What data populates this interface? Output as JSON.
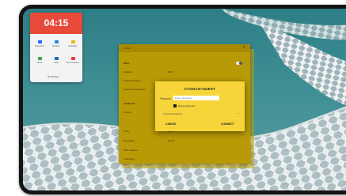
{
  "widget": {
    "clock": "04:15",
    "quick_settings": [
      {
        "label": "Bluetooth",
        "color": "#2962ff"
      },
      {
        "label": "Rotation",
        "color": "#1e88e5"
      },
      {
        "label": "Flashlight",
        "color": "#f2b800"
      },
      {
        "label": "Wi-Fi",
        "color": "#43a047"
      },
      {
        "label": "Data",
        "color": "#1565c0"
      },
      {
        "label": "Do not disturb",
        "color": "#e53935"
      }
    ],
    "settings_label": "Settings"
  },
  "panel": {
    "title": "Wi-Fi",
    "rows": [
      {
        "label": "Wi-Fi",
        "value": ""
      },
      {
        "label": "Network",
        "value": "Wi-Fi"
      },
      {
        "label": "Saved networks",
        "value": ""
      },
      {
        "label": "Network preferences",
        "value": ""
      },
      {
        "label": "Advanced",
        "value": ""
      },
      {
        "label": "Privacy",
        "value": ""
      },
      {
        "label": "Proxy",
        "value": "None"
      },
      {
        "label": "IP settings",
        "value": "DHCP"
      },
      {
        "label": "MAC address",
        "value": ""
      },
      {
        "label": "Frequency",
        "value": ""
      }
    ]
  },
  "dialog": {
    "title": "CTOUCH-GUEST",
    "password_label": "Password",
    "password_placeholder": "Enter password",
    "show_password": "Show password",
    "advanced": "Advanced Options",
    "cancel": "CANCEL",
    "connect": "CONNECT"
  },
  "colors": {
    "accent": "#f6d43a",
    "clock_bg": "#e84a3a",
    "wallpaper": "#3a8890"
  }
}
